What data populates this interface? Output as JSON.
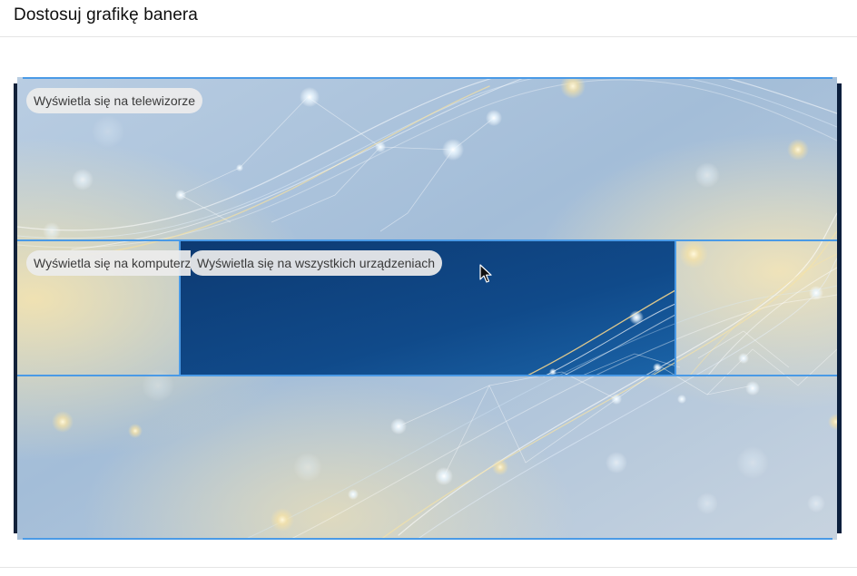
{
  "dialog": {
    "title": "Dostosuj grafikę banera"
  },
  "banner": {
    "labels": {
      "tv": "Wyświetla się na telewizorze",
      "desktop": "Wyświetla się na komputerze",
      "all_devices": "Wyświetla się na wszystkich urządzeniach"
    },
    "colors": {
      "crop_outline": "#4a9ae6",
      "safe_area_fill": "#0f3f79",
      "background_light": "#a9c2da"
    }
  },
  "icons": {
    "cursor": "mouse-pointer-icon"
  }
}
